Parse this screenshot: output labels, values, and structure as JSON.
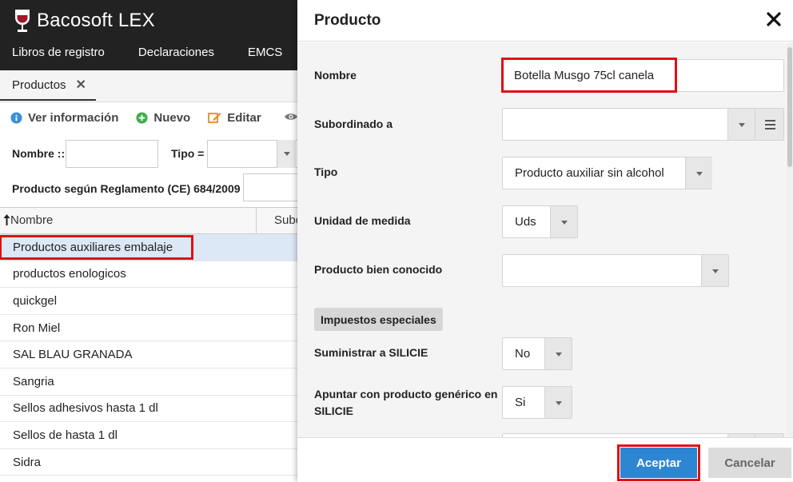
{
  "app": {
    "title": "Bacosoft LEX",
    "nav": [
      "Libros de registro",
      "Declaraciones",
      "EMCS"
    ]
  },
  "tab": {
    "label": "Productos",
    "close": "✕"
  },
  "toolbar": {
    "info": "Ver información",
    "new": "Nuevo",
    "edit": "Editar"
  },
  "filters": {
    "name_label": "Nombre ::",
    "type_label": "Tipo =",
    "regulation_label": "Producto según Reglamento (CE) 684/2009 ="
  },
  "grid": {
    "col_name": "Nombre",
    "col_sub": "Subo",
    "rows": [
      "Productos auxiliares embalaje",
      "productos enologicos",
      "quickgel",
      "Ron Miel",
      "SAL BLAU GRANADA",
      "Sangria",
      "Sellos adhesivos hasta 1 dl",
      "Sellos de hasta 1 dl",
      "Sidra"
    ]
  },
  "modal": {
    "title": "Producto",
    "fields": {
      "nombre": {
        "label": "Nombre",
        "value": "Botella Musgo 75cl canela"
      },
      "subordinado": {
        "label": "Subordinado a",
        "value": ""
      },
      "tipo": {
        "label": "Tipo",
        "value": "Producto auxiliar sin alcohol"
      },
      "unidad": {
        "label": "Unidad de medida",
        "value": "Uds"
      },
      "bien_conocido": {
        "label": "Producto bien conocido",
        "value": ""
      },
      "silicie": {
        "label": "Suministrar a SILICIE",
        "value": "No"
      },
      "generico": {
        "label": "Apuntar con producto genérico en SILICIE",
        "value": "Si"
      }
    },
    "section": "Impuestos especiales",
    "accept": "Aceptar",
    "cancel": "Cancelar"
  },
  "colors": {
    "topbar": "#222222",
    "accent": "#2d86d2",
    "highlight": "#e01010",
    "selected_row": "#dde8f7"
  }
}
